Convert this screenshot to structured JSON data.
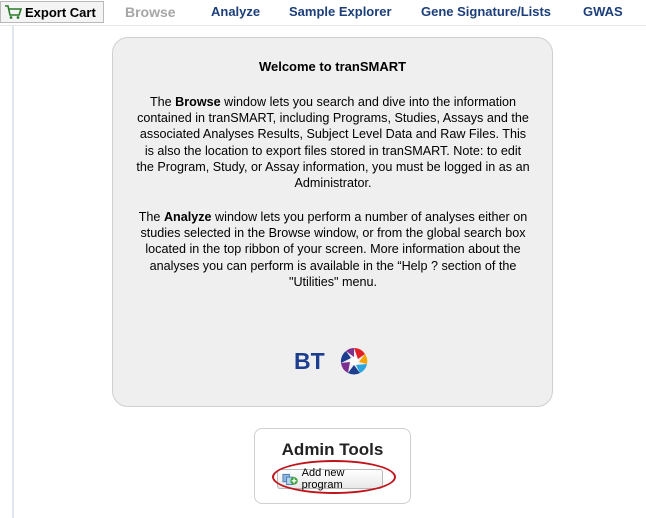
{
  "nav": {
    "cart_label": "Export Cart",
    "tabs": [
      {
        "label": "Browse",
        "active": true
      },
      {
        "label": "Analyze"
      },
      {
        "label": "Sample Explorer"
      },
      {
        "label": "Gene Signature/Lists"
      },
      {
        "label": "GWAS"
      }
    ]
  },
  "welcome": {
    "title": "Welcome to tranSMART",
    "p1": {
      "before": "The ",
      "bold": "Browse",
      "after": " window lets you search and dive into the information contained in tranSMART, including Programs, Studies, Assays and the associated Analyses Results, Subject Level Data and Raw Files. This is also the location to export files stored in tranSMART. Note: to edit the Program, Study, or Assay information, you must be logged in as an Administrator."
    },
    "p2": {
      "before": "The ",
      "bold": "Analyze",
      "after": " window lets you perform a number of analyses either on studies selected in the Browse window, or from the global search box located in the top ribbon of your screen. More information about the analyses you can perform is available in the “Help ? section of the \"Utilities\" menu."
    },
    "logo_text": "BT"
  },
  "admin": {
    "title": "Admin Tools",
    "add_program_label": "Add new program"
  },
  "colors": {
    "tab_text": "#1c3f7a",
    "highlight_ring": "#c0141b"
  }
}
